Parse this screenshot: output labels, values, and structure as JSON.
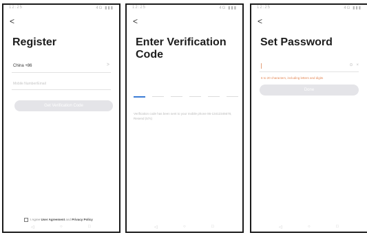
{
  "status_bar": {
    "left": "12:25",
    "right": "4G ▮▮▮"
  },
  "screens": {
    "register": {
      "back": "<",
      "title": "Register",
      "country_code": "China +86",
      "chevron": ">",
      "phone_placeholder": "Mobile Number/Email",
      "get_code_button": "Get Verification Code",
      "agreement_prefix": "I Agree",
      "user_agreement": "User Agreement",
      "and": "and",
      "privacy_policy": "Privacy Policy"
    },
    "verify": {
      "back": "<",
      "title": "Enter Verification Code",
      "hint": "Verification code has been sent to your mobile phone 86-13412345678, Resend (57s)"
    },
    "password": {
      "back": "<",
      "title": "Set Password",
      "eye_icon": "⊙",
      "clear_icon": "×",
      "rule": "6 to 20 characters, including letters and digits",
      "done_button": "Done"
    }
  },
  "nav_bar": {
    "back": "◁",
    "home": "○",
    "recents": "□"
  },
  "colors": {
    "button_disabled": "#e4e4e8",
    "accent": "#3a7bd5",
    "rule_text": "#e48755"
  }
}
